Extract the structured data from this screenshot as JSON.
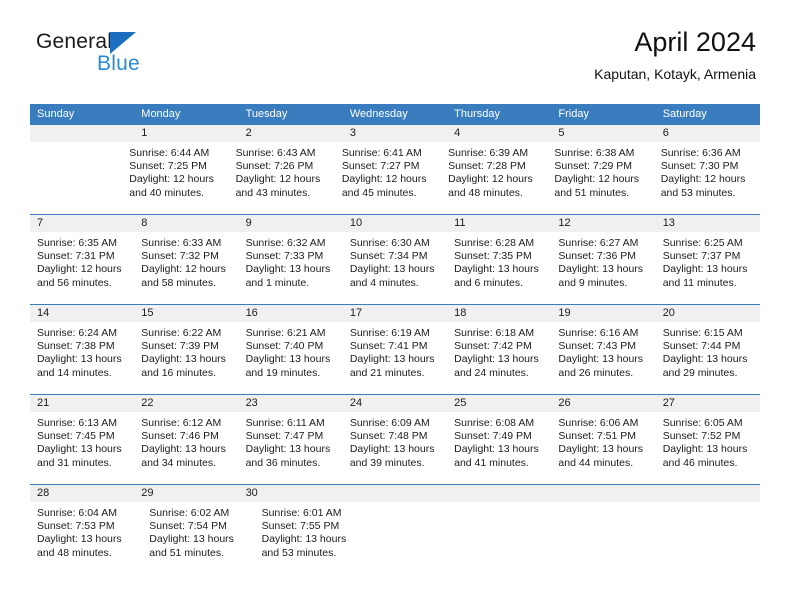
{
  "brand": {
    "name_part1": "General",
    "name_part2": "Blue",
    "flag_color": "#1c6fc0",
    "blue_text_color": "#2b8ad6"
  },
  "header": {
    "title": "April 2024",
    "subtitle": "Kaputan, Kotayk, Armenia"
  },
  "theme": {
    "header_row_bg": "#3a7dbf",
    "date_band_bg": "#f0f0f0",
    "cell_bg": "#ffffff",
    "divider": "#3a7dbf"
  },
  "weekdays": [
    "Sunday",
    "Monday",
    "Tuesday",
    "Wednesday",
    "Thursday",
    "Friday",
    "Saturday"
  ],
  "weeks": [
    {
      "days": [
        {
          "date": "",
          "sunrise": "",
          "sunset": "",
          "daylight_line1": "",
          "daylight_line2": ""
        },
        {
          "date": "1",
          "sunrise": "Sunrise: 6:44 AM",
          "sunset": "Sunset: 7:25 PM",
          "daylight_line1": "Daylight: 12 hours",
          "daylight_line2": "and 40 minutes."
        },
        {
          "date": "2",
          "sunrise": "Sunrise: 6:43 AM",
          "sunset": "Sunset: 7:26 PM",
          "daylight_line1": "Daylight: 12 hours",
          "daylight_line2": "and 43 minutes."
        },
        {
          "date": "3",
          "sunrise": "Sunrise: 6:41 AM",
          "sunset": "Sunset: 7:27 PM",
          "daylight_line1": "Daylight: 12 hours",
          "daylight_line2": "and 45 minutes."
        },
        {
          "date": "4",
          "sunrise": "Sunrise: 6:39 AM",
          "sunset": "Sunset: 7:28 PM",
          "daylight_line1": "Daylight: 12 hours",
          "daylight_line2": "and 48 minutes."
        },
        {
          "date": "5",
          "sunrise": "Sunrise: 6:38 AM",
          "sunset": "Sunset: 7:29 PM",
          "daylight_line1": "Daylight: 12 hours",
          "daylight_line2": "and 51 minutes."
        },
        {
          "date": "6",
          "sunrise": "Sunrise: 6:36 AM",
          "sunset": "Sunset: 7:30 PM",
          "daylight_line1": "Daylight: 12 hours",
          "daylight_line2": "and 53 minutes."
        }
      ]
    },
    {
      "days": [
        {
          "date": "7",
          "sunrise": "Sunrise: 6:35 AM",
          "sunset": "Sunset: 7:31 PM",
          "daylight_line1": "Daylight: 12 hours",
          "daylight_line2": "and 56 minutes."
        },
        {
          "date": "8",
          "sunrise": "Sunrise: 6:33 AM",
          "sunset": "Sunset: 7:32 PM",
          "daylight_line1": "Daylight: 12 hours",
          "daylight_line2": "and 58 minutes."
        },
        {
          "date": "9",
          "sunrise": "Sunrise: 6:32 AM",
          "sunset": "Sunset: 7:33 PM",
          "daylight_line1": "Daylight: 13 hours",
          "daylight_line2": "and 1 minute."
        },
        {
          "date": "10",
          "sunrise": "Sunrise: 6:30 AM",
          "sunset": "Sunset: 7:34 PM",
          "daylight_line1": "Daylight: 13 hours",
          "daylight_line2": "and 4 minutes."
        },
        {
          "date": "11",
          "sunrise": "Sunrise: 6:28 AM",
          "sunset": "Sunset: 7:35 PM",
          "daylight_line1": "Daylight: 13 hours",
          "daylight_line2": "and 6 minutes."
        },
        {
          "date": "12",
          "sunrise": "Sunrise: 6:27 AM",
          "sunset": "Sunset: 7:36 PM",
          "daylight_line1": "Daylight: 13 hours",
          "daylight_line2": "and 9 minutes."
        },
        {
          "date": "13",
          "sunrise": "Sunrise: 6:25 AM",
          "sunset": "Sunset: 7:37 PM",
          "daylight_line1": "Daylight: 13 hours",
          "daylight_line2": "and 11 minutes."
        }
      ]
    },
    {
      "days": [
        {
          "date": "14",
          "sunrise": "Sunrise: 6:24 AM",
          "sunset": "Sunset: 7:38 PM",
          "daylight_line1": "Daylight: 13 hours",
          "daylight_line2": "and 14 minutes."
        },
        {
          "date": "15",
          "sunrise": "Sunrise: 6:22 AM",
          "sunset": "Sunset: 7:39 PM",
          "daylight_line1": "Daylight: 13 hours",
          "daylight_line2": "and 16 minutes."
        },
        {
          "date": "16",
          "sunrise": "Sunrise: 6:21 AM",
          "sunset": "Sunset: 7:40 PM",
          "daylight_line1": "Daylight: 13 hours",
          "daylight_line2": "and 19 minutes."
        },
        {
          "date": "17",
          "sunrise": "Sunrise: 6:19 AM",
          "sunset": "Sunset: 7:41 PM",
          "daylight_line1": "Daylight: 13 hours",
          "daylight_line2": "and 21 minutes."
        },
        {
          "date": "18",
          "sunrise": "Sunrise: 6:18 AM",
          "sunset": "Sunset: 7:42 PM",
          "daylight_line1": "Daylight: 13 hours",
          "daylight_line2": "and 24 minutes."
        },
        {
          "date": "19",
          "sunrise": "Sunrise: 6:16 AM",
          "sunset": "Sunset: 7:43 PM",
          "daylight_line1": "Daylight: 13 hours",
          "daylight_line2": "and 26 minutes."
        },
        {
          "date": "20",
          "sunrise": "Sunrise: 6:15 AM",
          "sunset": "Sunset: 7:44 PM",
          "daylight_line1": "Daylight: 13 hours",
          "daylight_line2": "and 29 minutes."
        }
      ]
    },
    {
      "days": [
        {
          "date": "21",
          "sunrise": "Sunrise: 6:13 AM",
          "sunset": "Sunset: 7:45 PM",
          "daylight_line1": "Daylight: 13 hours",
          "daylight_line2": "and 31 minutes."
        },
        {
          "date": "22",
          "sunrise": "Sunrise: 6:12 AM",
          "sunset": "Sunset: 7:46 PM",
          "daylight_line1": "Daylight: 13 hours",
          "daylight_line2": "and 34 minutes."
        },
        {
          "date": "23",
          "sunrise": "Sunrise: 6:11 AM",
          "sunset": "Sunset: 7:47 PM",
          "daylight_line1": "Daylight: 13 hours",
          "daylight_line2": "and 36 minutes."
        },
        {
          "date": "24",
          "sunrise": "Sunrise: 6:09 AM",
          "sunset": "Sunset: 7:48 PM",
          "daylight_line1": "Daylight: 13 hours",
          "daylight_line2": "and 39 minutes."
        },
        {
          "date": "25",
          "sunrise": "Sunrise: 6:08 AM",
          "sunset": "Sunset: 7:49 PM",
          "daylight_line1": "Daylight: 13 hours",
          "daylight_line2": "and 41 minutes."
        },
        {
          "date": "26",
          "sunrise": "Sunrise: 6:06 AM",
          "sunset": "Sunset: 7:51 PM",
          "daylight_line1": "Daylight: 13 hours",
          "daylight_line2": "and 44 minutes."
        },
        {
          "date": "27",
          "sunrise": "Sunrise: 6:05 AM",
          "sunset": "Sunset: 7:52 PM",
          "daylight_line1": "Daylight: 13 hours",
          "daylight_line2": "and 46 minutes."
        }
      ]
    },
    {
      "days": [
        {
          "date": "28",
          "sunrise": "Sunrise: 6:04 AM",
          "sunset": "Sunset: 7:53 PM",
          "daylight_line1": "Daylight: 13 hours",
          "daylight_line2": "and 48 minutes."
        },
        {
          "date": "29",
          "sunrise": "Sunrise: 6:02 AM",
          "sunset": "Sunset: 7:54 PM",
          "daylight_line1": "Daylight: 13 hours",
          "daylight_line2": "and 51 minutes."
        },
        {
          "date": "30",
          "sunrise": "Sunrise: 6:01 AM",
          "sunset": "Sunset: 7:55 PM",
          "daylight_line1": "Daylight: 13 hours",
          "daylight_line2": "and 53 minutes."
        },
        {
          "date": "",
          "sunrise": "",
          "sunset": "",
          "daylight_line1": "",
          "daylight_line2": ""
        },
        {
          "date": "",
          "sunrise": "",
          "sunset": "",
          "daylight_line1": "",
          "daylight_line2": ""
        },
        {
          "date": "",
          "sunrise": "",
          "sunset": "",
          "daylight_line1": "",
          "daylight_line2": ""
        },
        {
          "date": "",
          "sunrise": "",
          "sunset": "",
          "daylight_line1": "",
          "daylight_line2": ""
        }
      ]
    }
  ]
}
